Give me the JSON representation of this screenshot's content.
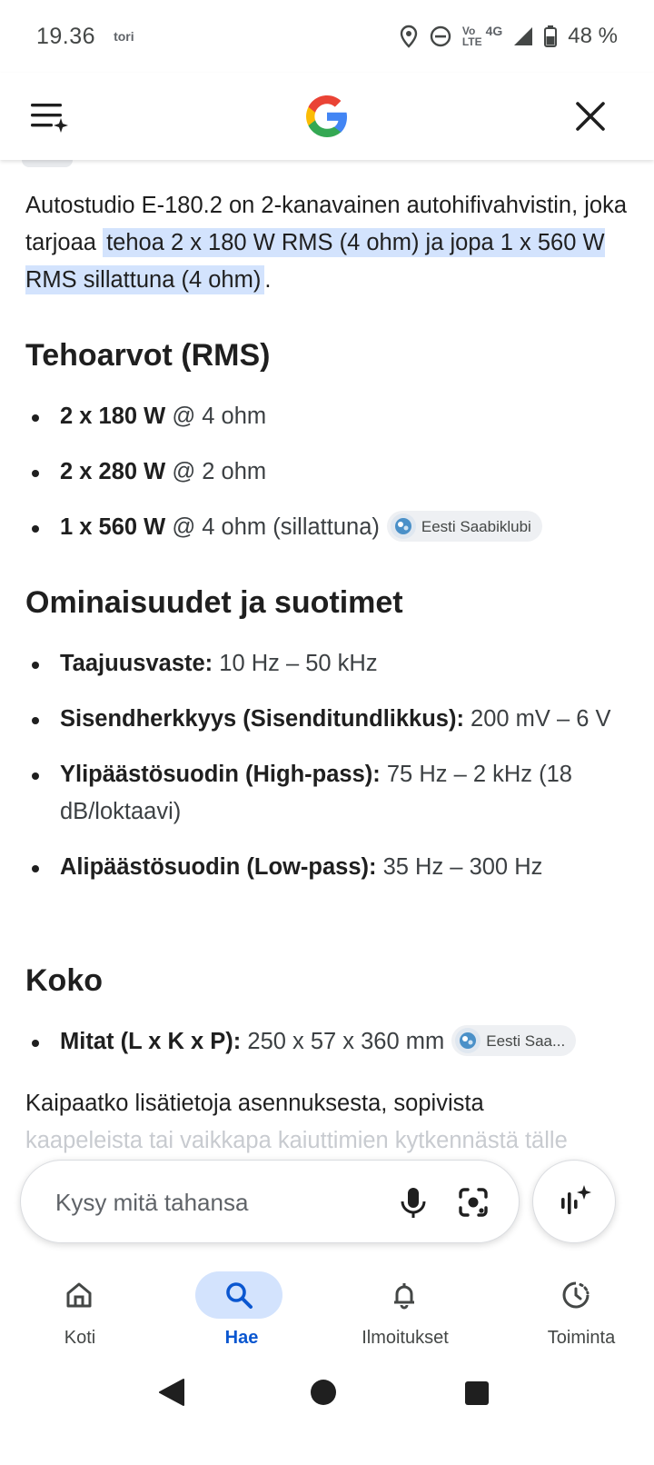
{
  "status_bar": {
    "time": "19.36",
    "carrier": "tori",
    "network_top": "Vo",
    "network_bottom": "LTE",
    "network_gen": "4G",
    "battery": "48 %"
  },
  "header": {
    "logo": "google-g-logo",
    "menu_icon": "menu-sparkle-icon",
    "close_icon": "close-icon"
  },
  "answer": {
    "intro_plain": "Autostudio E-180.2 on 2-kanavainen autohifivahvistin, joka tarjoaa ",
    "intro_highlight": "tehoa 2 x 180 W RMS (4 ohm) ja jopa 1 x 560 W RMS sillattuna (4 ohm)",
    "intro_end": ".",
    "sections": [
      {
        "heading": "Tehoarvot (RMS)",
        "items": [
          {
            "bold": "2 x 180 W",
            "text": " @ 4 ohm"
          },
          {
            "bold": "2 x 280 W",
            "text": " @ 2 ohm"
          },
          {
            "bold": "1 x 560 W",
            "text": " @ 4 ohm (sillattuna)",
            "source": "Eesti Saabiklubi"
          }
        ]
      },
      {
        "heading": "Ominaisuudet ja suotimet",
        "items": [
          {
            "bold": "Taajuusvaste:",
            "text": " 10 Hz – 50 kHz"
          },
          {
            "bold": "Sisendherkkyys (Sisenditundlikkus):",
            "text": " 200 mV – 6 V"
          },
          {
            "bold": "Ylipäästösuodin (High-pass):",
            "text": " 75 Hz – 2 kHz (18 dB/loktaavi)"
          },
          {
            "bold": "Alipäästösuodin (Low-pass):",
            "text": " 35 Hz – 300 Hz"
          }
        ]
      },
      {
        "heading": "Koko",
        "items": [
          {
            "bold": "Mitat (L x K x P):",
            "text": " 250 x 57 x 360 mm",
            "source": "Eesti Saa..."
          }
        ]
      }
    ],
    "outro_line1": "Kaipaatko lisätietoja asennuksesta, sopivista",
    "outro_line2": "kaapeleista tai vaikkapa kaiuttimien kytkennästä tälle"
  },
  "ask_bar": {
    "placeholder": "Kysy mitä tahansa"
  },
  "bottom_nav": [
    {
      "label": "Koti",
      "icon": "home-icon",
      "active": false
    },
    {
      "label": "Hae",
      "icon": "search-icon",
      "active": true
    },
    {
      "label": "Ilmoitukset",
      "icon": "bell-icon",
      "active": false
    },
    {
      "label": "Toiminta",
      "icon": "activity-icon",
      "active": false
    }
  ],
  "colors": {
    "highlight": "#d3e3fd",
    "active_blue": "#0b57d0",
    "text": "#1f1f1f"
  }
}
